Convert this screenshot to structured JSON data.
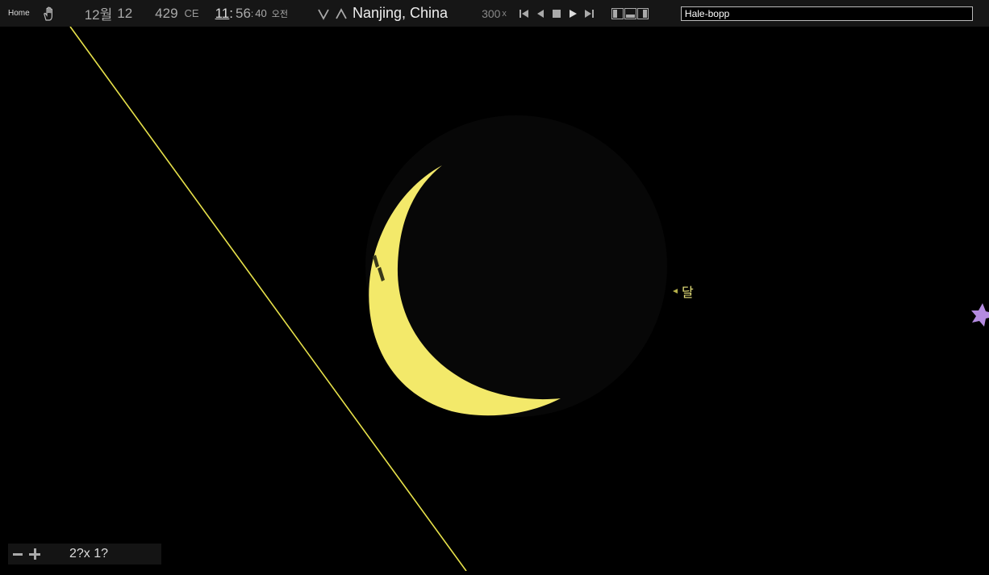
{
  "toolbar": {
    "home_label": "Home",
    "month": "12월",
    "day": "12",
    "year": "429",
    "era": "CE",
    "hour": "11",
    "minute": "56",
    "second": "40",
    "ampm": "오전",
    "location": "Nanjing, China",
    "speed": "300",
    "speed_unit": "x",
    "search_value": "Hale-bopp"
  },
  "sky": {
    "moon_label": "달",
    "moon_lit_color": "#f3e96a",
    "moon_dark_color": "#0a0a0a",
    "horizon_line_color": "#e8e24a",
    "marker_color": "#b48be0"
  },
  "zoom": {
    "fov": "2?x 1?"
  },
  "icons": {
    "pan": "hand-icon",
    "menu": "hamburger-icon",
    "down": "chevron-down-icon",
    "up": "chevron-up-icon",
    "skip_back": "skip-back-icon",
    "step_back": "step-back-icon",
    "stop": "stop-icon",
    "play": "play-icon",
    "skip_forward": "skip-forward-icon",
    "layout": "layout-icon"
  }
}
